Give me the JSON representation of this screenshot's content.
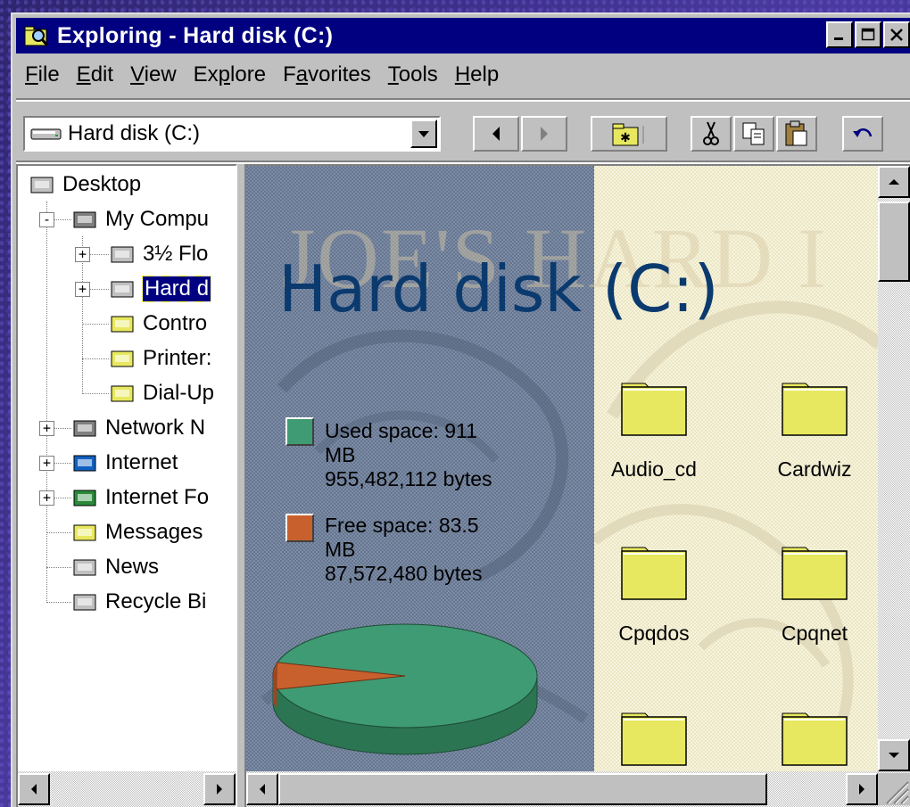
{
  "window": {
    "title": "Exploring - Hard disk (C:)"
  },
  "menu": [
    "File",
    "Edit",
    "View",
    "Explore",
    "Favorites",
    "Tools",
    "Help"
  ],
  "menu_underline": [
    "F",
    "E",
    "V",
    "p",
    "a",
    "T",
    "H"
  ],
  "address": {
    "value": "Hard disk (C:)"
  },
  "tree": {
    "items": [
      {
        "label": "Desktop",
        "icon": "desktop-icon"
      },
      {
        "label": "My Compu",
        "icon": "my-computer-icon"
      },
      {
        "label": "3½ Flo",
        "icon": "floppy-drive-icon"
      },
      {
        "label": "Hard d",
        "icon": "hard-drive-icon"
      },
      {
        "label": "Contro",
        "icon": "control-panel-icon"
      },
      {
        "label": "Printer:",
        "icon": "printers-folder-icon"
      },
      {
        "label": "Dial-Up",
        "icon": "dial-up-networking-icon"
      },
      {
        "label": "Network N",
        "icon": "network-neighborhood-icon"
      },
      {
        "label": "Internet",
        "icon": "internet-icon"
      },
      {
        "label": "Internet Fo",
        "icon": "internet-folder-icon"
      },
      {
        "label": "Messages",
        "icon": "messages-icon"
      },
      {
        "label": "News",
        "icon": "news-icon"
      },
      {
        "label": "Recycle Bi",
        "icon": "recycle-bin-icon"
      }
    ]
  },
  "view": {
    "title": "Hard disk (C:)",
    "watermark": "JOE'S HARD I",
    "legend": {
      "used_label": "Used space: 911",
      "used_unit": "MB",
      "used_bytes": "955,482,112 bytes",
      "free_label": "Free space: 83.5",
      "free_unit": "MB",
      "free_bytes": "87,572,480 bytes"
    },
    "folders": [
      "Audio_cd",
      "Cardwiz",
      "Cpqdos",
      "Cpqnet"
    ]
  },
  "disk_usage": {
    "used_mb": 911,
    "free_mb": 83.5,
    "used_fraction": 0.916
  },
  "colors": {
    "title_bar": "#000080",
    "used_space": "#3f9b73",
    "free_space": "#c8602e",
    "folder": "#e8e860",
    "folder_title": "#0b3a6e"
  }
}
